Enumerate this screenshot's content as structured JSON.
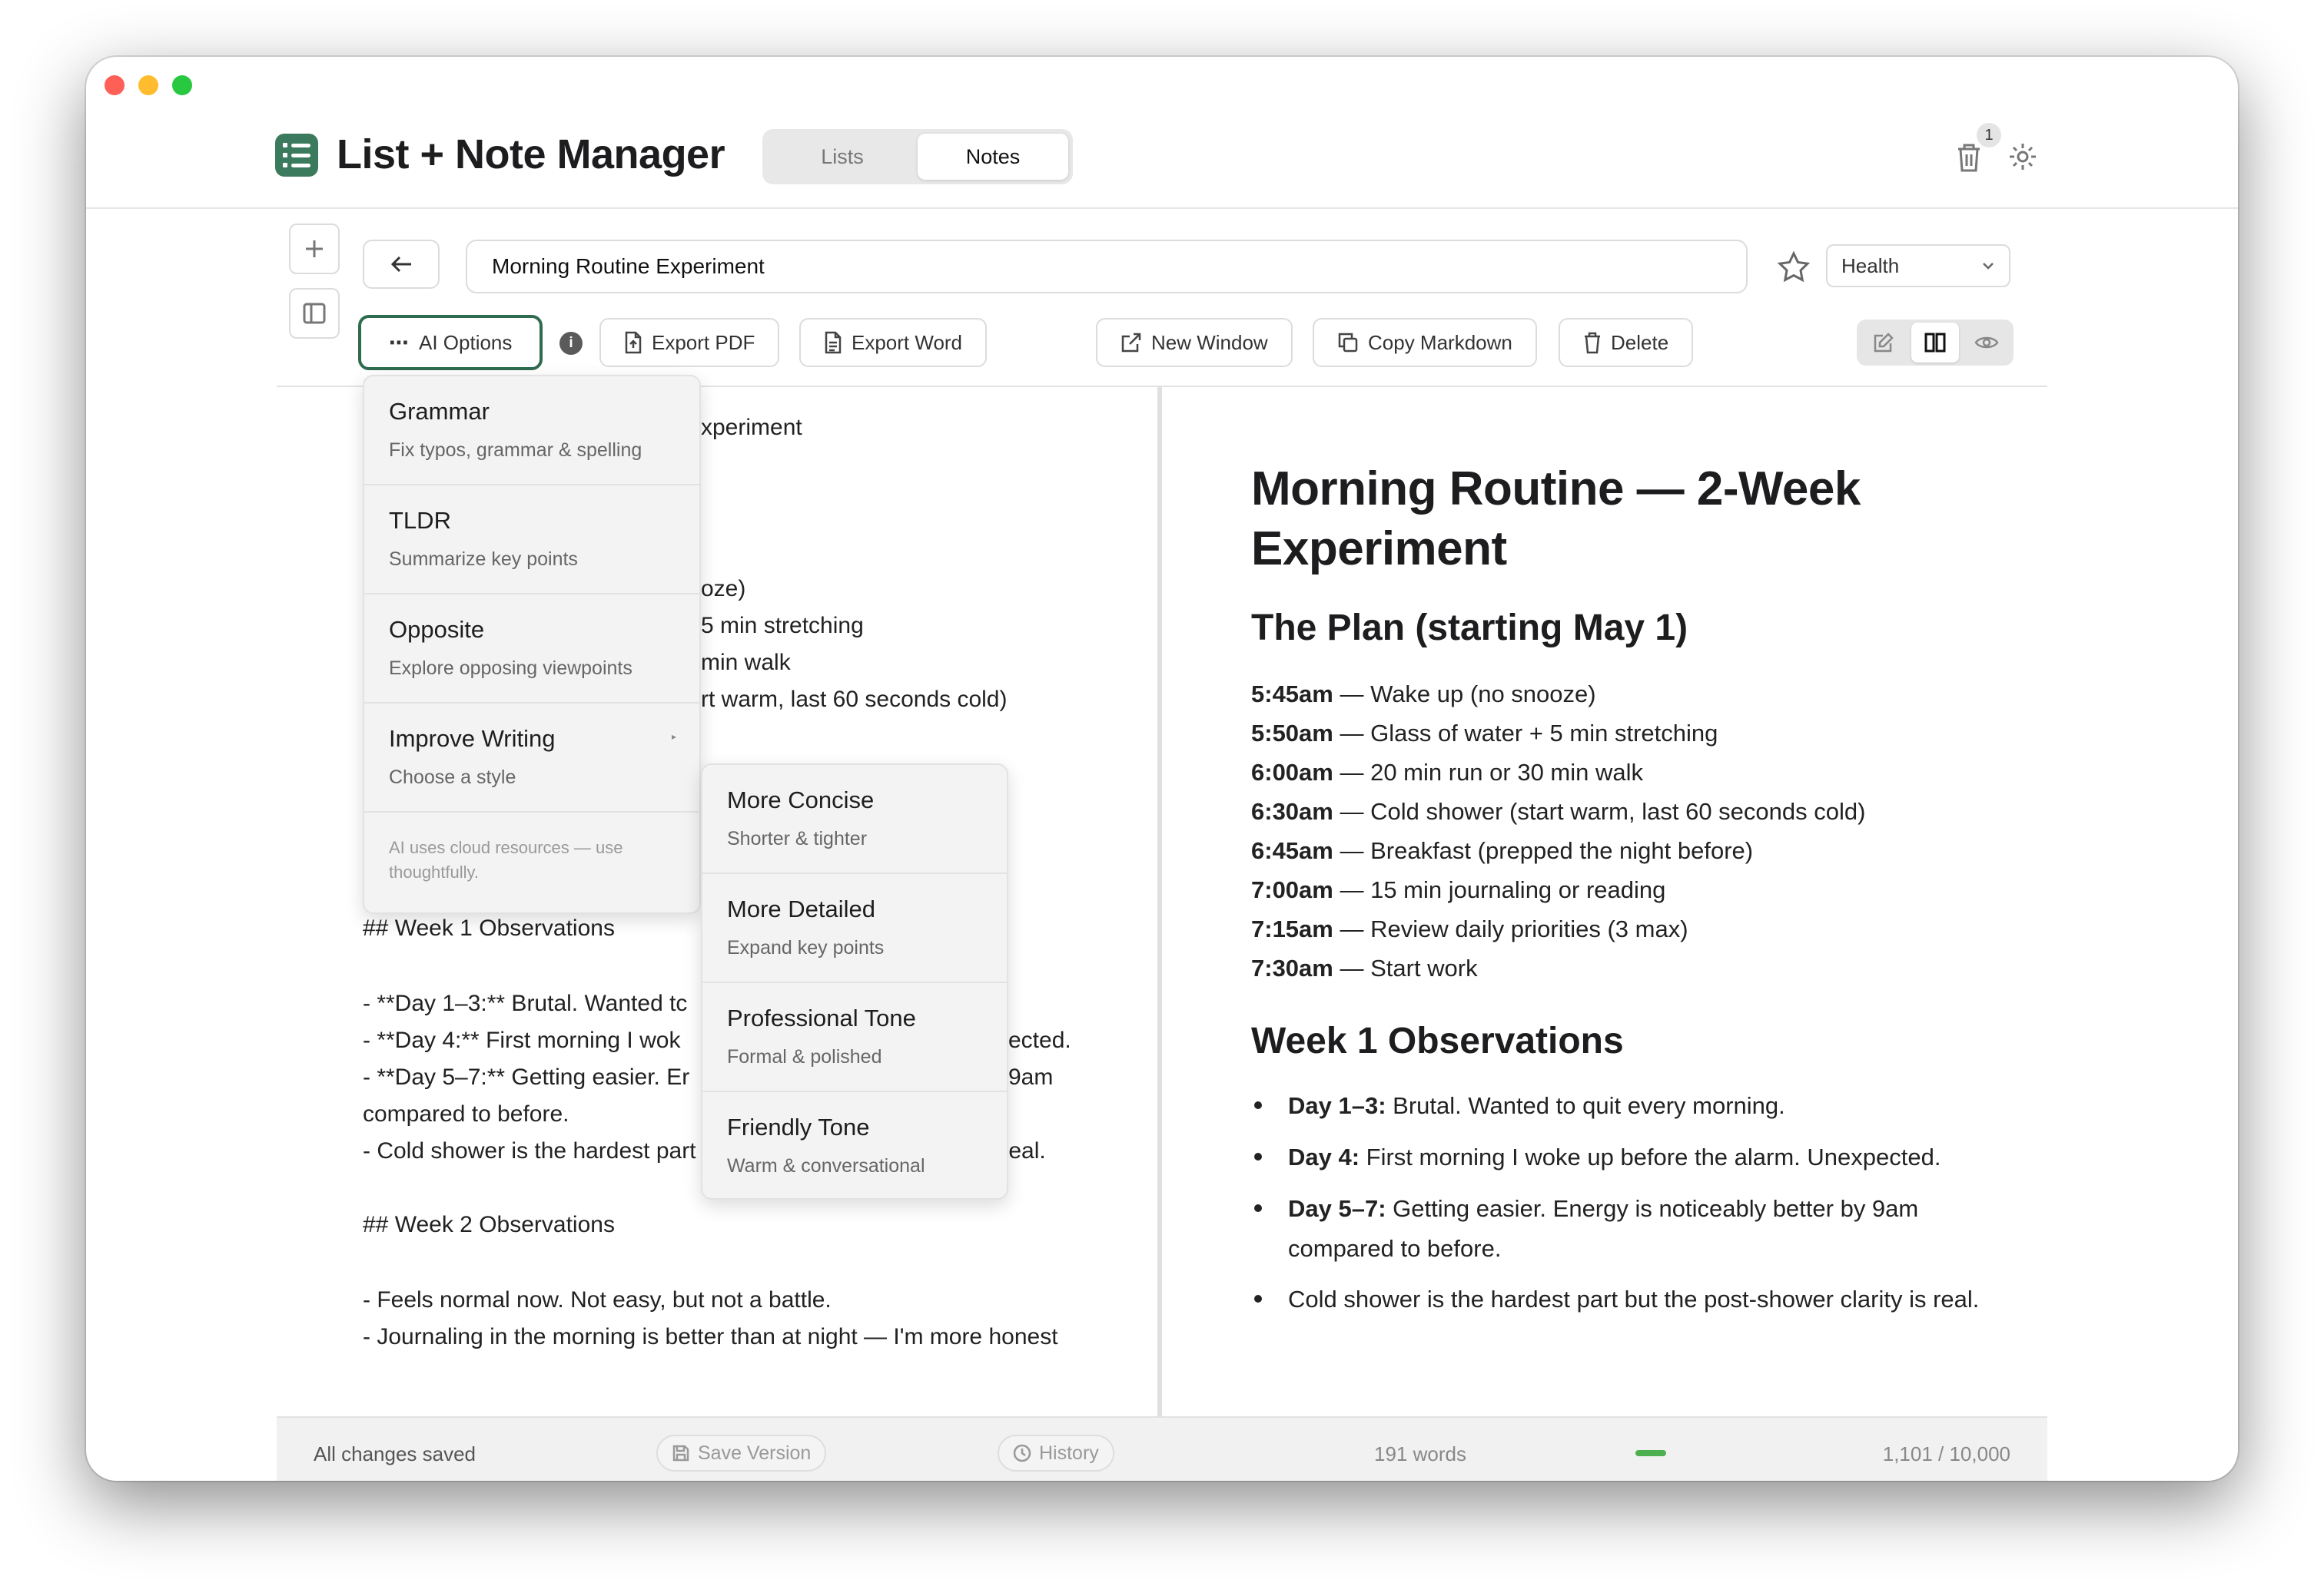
{
  "app": {
    "title": "List + Note Manager",
    "tabs": [
      "Lists",
      "Notes"
    ],
    "active_tab": "Notes",
    "trash_count": "1"
  },
  "note": {
    "title": "Morning Routine Experiment",
    "category": "Health"
  },
  "toolbar": {
    "ai_options": "AI Options",
    "export_pdf": "Export PDF",
    "export_word": "Export Word",
    "new_window": "New Window",
    "copy_markdown": "Copy Markdown",
    "delete": "Delete"
  },
  "ai_menu": {
    "items": [
      {
        "title": "Grammar",
        "desc": "Fix typos, grammar & spelling"
      },
      {
        "title": "TLDR",
        "desc": "Summarize key points"
      },
      {
        "title": "Opposite",
        "desc": "Explore opposing viewpoints"
      },
      {
        "title": "Improve Writing",
        "desc": "Choose a style"
      }
    ],
    "note": "AI uses cloud resources — use thoughtfully.",
    "submenu": [
      {
        "title": "More Concise",
        "desc": "Shorter & tighter"
      },
      {
        "title": "More Detailed",
        "desc": "Expand key points"
      },
      {
        "title": "Professional Tone",
        "desc": "Formal & polished"
      },
      {
        "title": "Friendly Tone",
        "desc": "Warm & conversational"
      }
    ]
  },
  "source": {
    "lines": [
      "xperiment",
      "oze)",
      "5 min stretching",
      "min walk",
      "rt warm, last 60 seconds cold)",
      "## Week 1 Observations",
      "- **Day 1–3:** Brutal. Wanted tc",
      "- **Day 4:** First morning I wok",
      "ected.",
      "- **Day 5–7:** Getting easier. Er",
      "9am",
      "compared to before.",
      "- Cold shower is the hardest part but the post-shower clarity is real.",
      "## Week 2 Observations",
      "- Feels normal now. Not easy, but not a battle.",
      "- Journaling in the morning is better than at night — I'm more honest"
    ]
  },
  "preview": {
    "h1": "Morning Routine — 2-Week Experiment",
    "plan_heading": "The Plan (starting May 1)",
    "schedule": [
      {
        "time": "5:45am",
        "text": " — Wake up (no snooze)"
      },
      {
        "time": "5:50am",
        "text": " — Glass of water + 5 min stretching"
      },
      {
        "time": "6:00am",
        "text": " — 20 min run or 30 min walk"
      },
      {
        "time": "6:30am",
        "text": " — Cold shower (start warm, last 60 seconds cold)"
      },
      {
        "time": "6:45am",
        "text": " — Breakfast (prepped the night before)"
      },
      {
        "time": "7:00am",
        "text": " — 15 min journaling or reading"
      },
      {
        "time": "7:15am",
        "text": " — Review daily priorities (3 max)"
      },
      {
        "time": "7:30am",
        "text": " — Start work"
      }
    ],
    "week1_heading": "Week 1 Observations",
    "bullets": [
      {
        "bold": "Day 1–3:",
        "text": " Brutal. Wanted to quit every morning."
      },
      {
        "bold": "Day 4:",
        "text": " First morning I woke up before the alarm. Unexpected."
      },
      {
        "bold": "Day 5–7:",
        "text": " Getting easier. Energy is noticeably better by 9am compared to before."
      },
      {
        "bold": "",
        "text": "Cold shower is the hardest part but the post-shower clarity is real."
      }
    ]
  },
  "status": {
    "saved": "All changes saved",
    "save_version": "Save Version",
    "history": "History",
    "words": "191 words",
    "progress": 0.11,
    "chars": "1,101 / 10,000"
  },
  "colors": {
    "accent": "#2f6b4f",
    "progress": "#4caf50"
  }
}
